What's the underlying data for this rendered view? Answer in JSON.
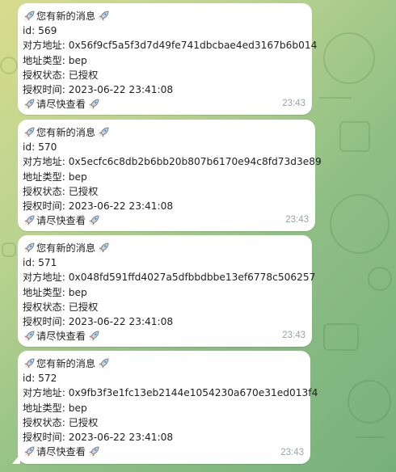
{
  "chat": {
    "messages": [
      {
        "header": "您有新的消息",
        "id_label": "id:",
        "id": "569",
        "address_label": "对方地址:",
        "address": "0x56f9cf5a5f3d7d49fe741dbcbae4ed3167b6b014",
        "addr_type_label": "地址类型:",
        "addr_type": "bep",
        "auth_status_label": "授权状态:",
        "auth_status": "已授权",
        "auth_time_label": "授权时间:",
        "auth_time": "2023-06-22 23:41:08",
        "footer": "请尽快查看",
        "time": "23:43"
      },
      {
        "header": "您有新的消息",
        "id_label": "id:",
        "id": "570",
        "address_label": "对方地址:",
        "address": "0x5ecfc6c8db2b6bb20b807b6170e94c8fd73d3e89",
        "addr_type_label": "地址类型:",
        "addr_type": "bep",
        "auth_status_label": "授权状态:",
        "auth_status": "已授权",
        "auth_time_label": "授权时间:",
        "auth_time": "2023-06-22 23:41:08",
        "footer": "请尽快查看",
        "time": "23:43"
      },
      {
        "header": "您有新的消息",
        "id_label": "id:",
        "id": "571",
        "address_label": "对方地址:",
        "address": "0x048fd591ffd4027a5dfbbdbbe13ef6778c506257",
        "addr_type_label": "地址类型:",
        "addr_type": "bep",
        "auth_status_label": "授权状态:",
        "auth_status": "已授权",
        "auth_time_label": "授权时间:",
        "auth_time": "2023-06-22 23:41:08",
        "footer": "请尽快查看",
        "time": "23:43"
      },
      {
        "header": "您有新的消息",
        "id_label": "id:",
        "id": "572",
        "address_label": "对方地址:",
        "address": "0x9fb3f3e1fc13eb2144e1054230a670e31ed013f4",
        "addr_type_label": "地址类型:",
        "addr_type": "bep",
        "auth_status_label": "授权状态:",
        "auth_status": "已授权",
        "auth_time_label": "授权时间:",
        "auth_time": "2023-06-22 23:41:08",
        "footer": "请尽快查看",
        "time": "23:43"
      }
    ]
  },
  "icons": {
    "rocket": "rocket-icon"
  },
  "colors": {
    "bubble": "#ffffff",
    "time": "#9aa3a8",
    "background_light": "#d8dc8e",
    "background_dark": "#78b07c"
  }
}
